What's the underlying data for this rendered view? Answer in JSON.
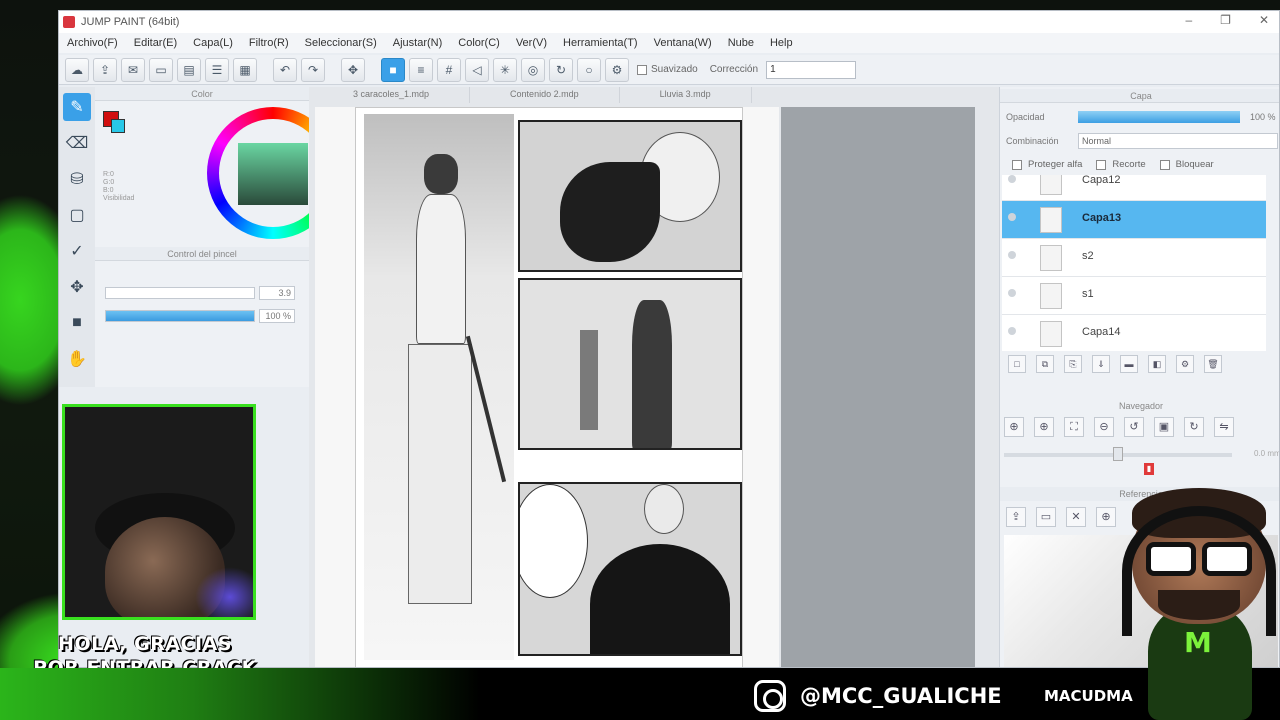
{
  "window": {
    "title": "JUMP PAINT (64bit)",
    "controls": [
      "–",
      "❐",
      "✕"
    ]
  },
  "menu": [
    "Archivo(F)",
    "Editar(E)",
    "Capa(L)",
    "Filtro(R)",
    "Seleccionar(S)",
    "Ajustar(N)",
    "Color(C)",
    "Ver(V)",
    "Herramienta(T)",
    "Ventana(W)",
    "Nube",
    "Help"
  ],
  "toolbar": {
    "smoothing_label": "Suavizado",
    "correction_label": "Corrección",
    "correction_value": "1"
  },
  "color_panel": {
    "title": "Color",
    "values": [
      "R:0",
      "G:0",
      "B:0",
      "Visibilidad"
    ],
    "fg_color": "#d10f0f",
    "bg_color": "#28c8e8"
  },
  "brush_panel": {
    "title": "Control del pincel",
    "size_value": "3.9",
    "opacity_value": "100 %",
    "size_fill": 0.97,
    "opacity_fill": 1.0
  },
  "canvas": {
    "tabs": [
      "3 caracoles_1.mdp",
      "Contenido 2.mdp",
      "Lluvia 3.mdp"
    ]
  },
  "layer_panel": {
    "title": "Capa",
    "opacity_label": "Opacidad",
    "opacity_value": "100 %",
    "blend_label": "Combinación",
    "blend_value": "Normal",
    "checks": [
      "Proteger alfa",
      "Recorte",
      "Bloquear"
    ],
    "layers": [
      {
        "name": "Capa12",
        "selected": false
      },
      {
        "name": "Capa13",
        "selected": true
      },
      {
        "name": "s2",
        "selected": false
      },
      {
        "name": "s1",
        "selected": false
      },
      {
        "name": "Capa14",
        "selected": false
      }
    ]
  },
  "navigator": {
    "title": "Navegador",
    "zoom": "0.0 mm",
    "slider_level": 0.5
  },
  "reference": {
    "title": "Referencia"
  },
  "overlay": {
    "greeting_line1": "HOLA, GRACIAS",
    "greeting_line2": "POR ENTRAR CRACK",
    "handle": "@MCC_GUALICHE",
    "brand": "MACUDMA",
    "avatar_logo": "M"
  },
  "colors": {
    "accent": "#3aa0e8",
    "overlay_green": "#39e01f",
    "selected_layer": "#56b7f0"
  }
}
